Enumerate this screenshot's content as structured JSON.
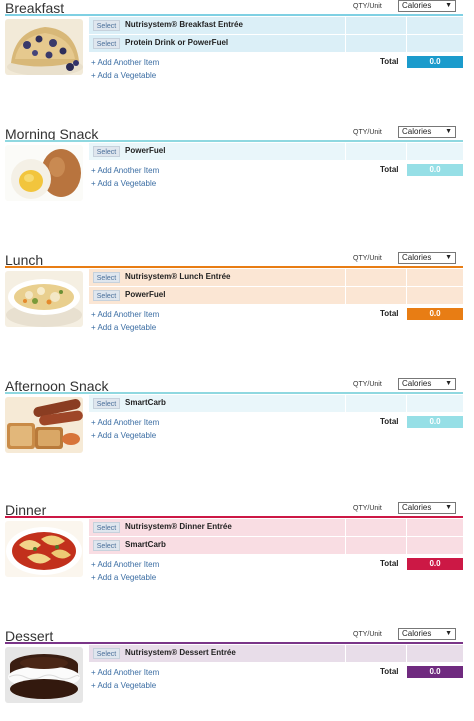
{
  "common": {
    "qty_label": "QTY/Unit",
    "calories_option": "Calories",
    "dropdown_arrow": "▼",
    "select_label": "Select",
    "add_item": "+ Add Another Item",
    "add_vegetable": "+ Add a Vegetable",
    "total_label": "Total"
  },
  "meals": [
    {
      "title": "Breakfast",
      "items": [
        "Nutrisystem® Breakfast Entrée",
        "Protein Drink or PowerFuel"
      ],
      "total": "0.0",
      "accent": "#1b9bcc",
      "rule": "#7fd0e3",
      "row_bg": "#dbeff7",
      "photo": "blueberry-muffin"
    },
    {
      "title": "Morning Snack",
      "items": [
        "PowerFuel"
      ],
      "total": "0.0",
      "accent": "#96dfe6",
      "rule": "#8fd8e0",
      "row_bg": "#e9f6fa",
      "photo": "eggs"
    },
    {
      "title": "Lunch",
      "items": [
        "Nutrisystem® Lunch Entrée",
        "PowerFuel"
      ],
      "total": "0.0",
      "accent": "#e87d14",
      "rule": "#e87d14",
      "row_bg": "#fbe6d4",
      "photo": "chicken-soup"
    },
    {
      "title": "Afternoon Snack",
      "items": [
        "SmartCarb"
      ],
      "total": "0.0",
      "accent": "#96dfe6",
      "rule": "#8fd8e0",
      "row_bg": "#e9f6fa",
      "photo": "sausages-and-bread"
    },
    {
      "title": "Dinner",
      "items": [
        "Nutrisystem® Dinner Entrée",
        "SmartCarb"
      ],
      "total": "0.0",
      "accent": "#cc1845",
      "rule": "#cc1845",
      "row_bg": "#f9dde3",
      "photo": "ravioli"
    },
    {
      "title": "Dessert",
      "items": [
        "Nutrisystem® Dessert Entrée"
      ],
      "total": "0.0",
      "accent": "#6f2a7f",
      "rule": "#7a3588",
      "row_bg": "#e8dde9",
      "photo": "ice-cream-sandwich"
    }
  ]
}
